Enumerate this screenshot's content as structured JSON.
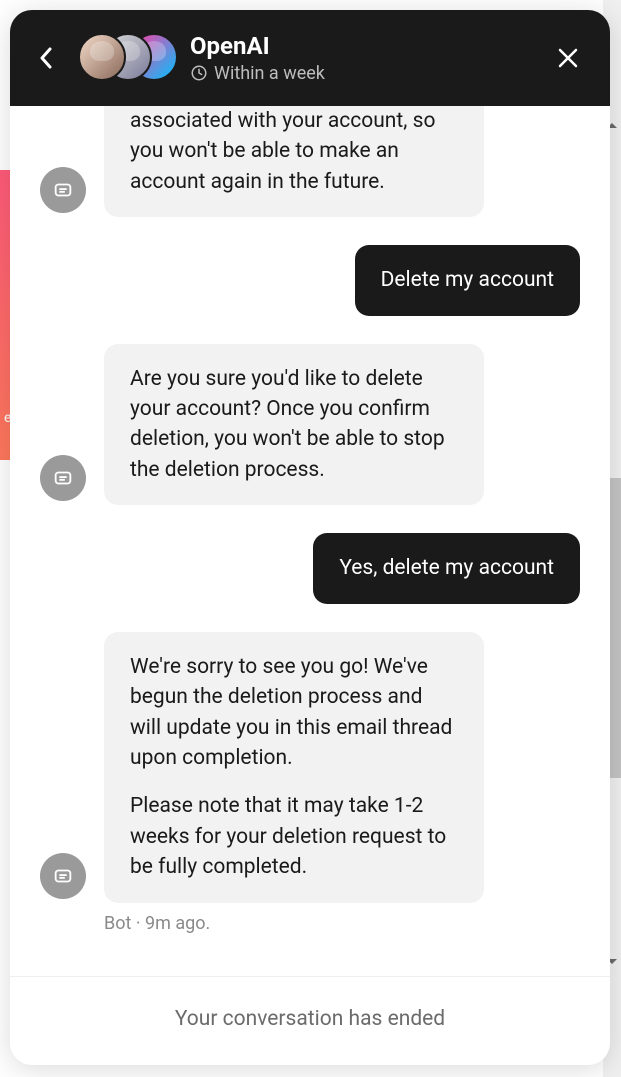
{
  "header": {
    "title": "OpenAI",
    "subtitle": "Within a week"
  },
  "messages": {
    "bot1": "associated with your account, so you won't be able to make an account again in the future.",
    "user1": "Delete my account",
    "bot2": "Are you sure you'd like to delete your account? Once you confirm deletion, you won't be able to stop the deletion process.",
    "user2": "Yes, delete my account",
    "bot3_p1": "We're sorry to see you go! We've begun the deletion process and will update you in this email thread upon completion.",
    "bot3_p2": "Please note that it may take 1-2 weeks for your deletion request to be fully completed."
  },
  "meta": "Bot · 9m ago.",
  "footer": "Your conversation has ended",
  "bg_strip_char": "e"
}
